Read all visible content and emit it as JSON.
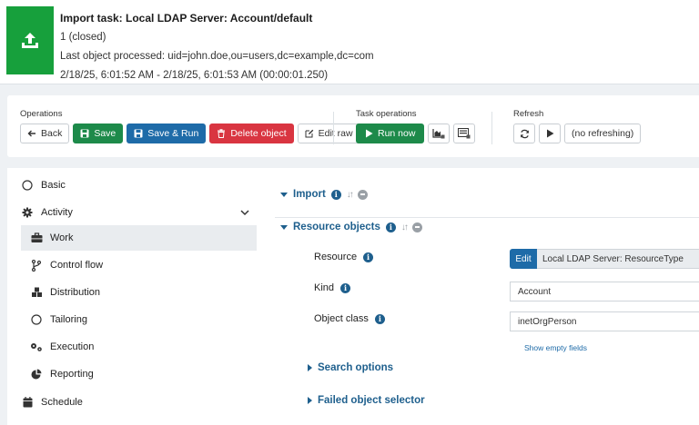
{
  "header": {
    "title": "Import task: Local LDAP Server: Account/default",
    "status": "1 (closed)",
    "last_object": "Last object processed: uid=john.doe,ou=users,dc=example,dc=com",
    "time_range": "2/18/25, 6:01:52 AM - 2/18/25, 6:01:53 AM (00:00:01.250)",
    "icon": "upload-icon",
    "icon_color": "#17a03c"
  },
  "toolbar": {
    "operations_label": "Operations",
    "back_label": "Back",
    "save_label": "Save",
    "save_run_label": "Save & Run",
    "delete_label": "Delete object",
    "edit_raw_label": "Edit raw",
    "task_ops_label": "Task operations",
    "run_now_label": "Run now",
    "refresh_label": "Refresh",
    "no_refresh_label": "(no refreshing)"
  },
  "sidebar": {
    "items": [
      {
        "label": "Basic",
        "icon": "circle-outline-icon"
      },
      {
        "label": "Activity",
        "icon": "gear-icon"
      },
      {
        "label": "Work",
        "icon": "briefcase-icon"
      },
      {
        "label": "Control flow",
        "icon": "branch-icon"
      },
      {
        "label": "Distribution",
        "icon": "cubes-icon"
      },
      {
        "label": "Tailoring",
        "icon": "circle-outline-icon"
      },
      {
        "label": "Execution",
        "icon": "gears-icon"
      },
      {
        "label": "Reporting",
        "icon": "pie-chart-icon"
      },
      {
        "label": "Schedule",
        "icon": "calendar-icon"
      }
    ]
  },
  "content": {
    "import_title": "Import",
    "resource_objects_title": "Resource objects",
    "resource_label": "Resource",
    "edit_label": "Edit",
    "resource_value": "Local LDAP Server: ResourceType",
    "kind_label": "Kind",
    "kind_value": "Account",
    "object_class_label": "Object class",
    "object_class_value": "inetOrgPerson",
    "show_empty_label": "Show empty fields",
    "search_options_title": "Search options",
    "failed_selector_title": "Failed object selector"
  },
  "colors": {
    "accent": "#1e5f8d",
    "green": "#1d8a4a",
    "blue": "#1e6ba8",
    "red": "#d93541"
  }
}
